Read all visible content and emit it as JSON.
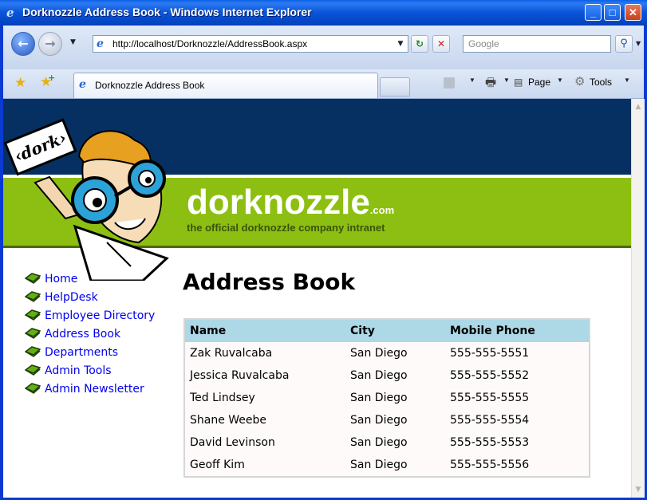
{
  "window": {
    "title": "Dorknozzle Address Book - Windows Internet Explorer"
  },
  "addressbar": {
    "url": "http://localhost/Dorknozzle/AddressBook.aspx",
    "search_placeholder": "Google"
  },
  "tab": {
    "label": "Dorknozzle Address Book"
  },
  "commands": {
    "page": "Page",
    "tools": "Tools"
  },
  "site": {
    "brand": "dorknozzle",
    "brand_suffix": ".com",
    "tagline": "the official dorknozzle company intranet",
    "sign": "‹dork›"
  },
  "menu": [
    {
      "label": "Home"
    },
    {
      "label": "HelpDesk"
    },
    {
      "label": "Employee Directory"
    },
    {
      "label": "Address Book"
    },
    {
      "label": "Departments"
    },
    {
      "label": "Admin Tools"
    },
    {
      "label": "Admin Newsletter"
    }
  ],
  "page": {
    "heading": "Address Book"
  },
  "grid": {
    "columns": [
      "Name",
      "City",
      "Mobile Phone"
    ],
    "rows": [
      [
        "Zak Ruvalcaba",
        "San Diego",
        "555-555-5551"
      ],
      [
        "Jessica Ruvalcaba",
        "San Diego",
        "555-555-5552"
      ],
      [
        "Ted Lindsey",
        "San Diego",
        "555-555-5555"
      ],
      [
        "Shane Weebe",
        "San Diego",
        "555-555-5554"
      ],
      [
        "David Levinson",
        "San Diego",
        "555-555-5553"
      ],
      [
        "Geoff Kim",
        "San Diego",
        "555-555-5556"
      ]
    ]
  },
  "colors": {
    "header_bg": "#063061",
    "banner_green": "#8dbf12",
    "grid_header": "#add8e6"
  }
}
